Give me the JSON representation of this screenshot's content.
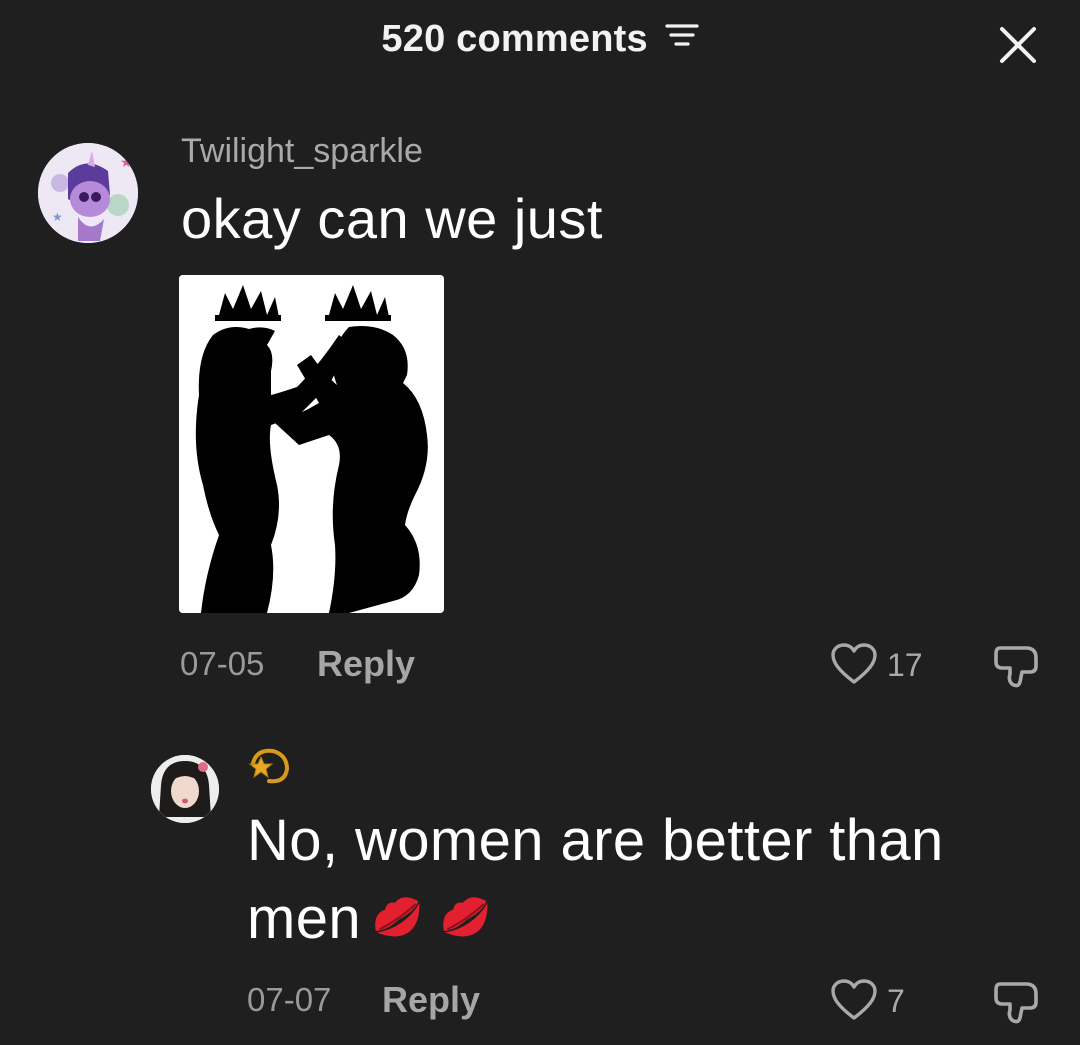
{
  "header": {
    "title": "520 comments",
    "filter_icon": "filter-lines-icon",
    "close_icon": "close-icon"
  },
  "comments": [
    {
      "username": "Twilight_sparkle",
      "text": "okay can we just",
      "date": "07-05",
      "reply_label": "Reply",
      "likes": "17",
      "avatar_icon": "pony-avatar",
      "image_icon": "crowned-couple-silhouette"
    },
    {
      "username_icon": "dizzy-star-emoji",
      "text": "No, women are better than men",
      "text_emojis": [
        "kiss-mark-emoji",
        "kiss-mark-emoji"
      ],
      "date": "07-07",
      "reply_label": "Reply",
      "likes": "7",
      "avatar_icon": "user-photo-avatar"
    }
  ],
  "colors": {
    "background": "#1f1f1f",
    "primary_text": "#ffffff",
    "secondary_text": "#a9a9a9",
    "kiss_red": "#e2202f",
    "star_gold": "#d99a1c"
  }
}
